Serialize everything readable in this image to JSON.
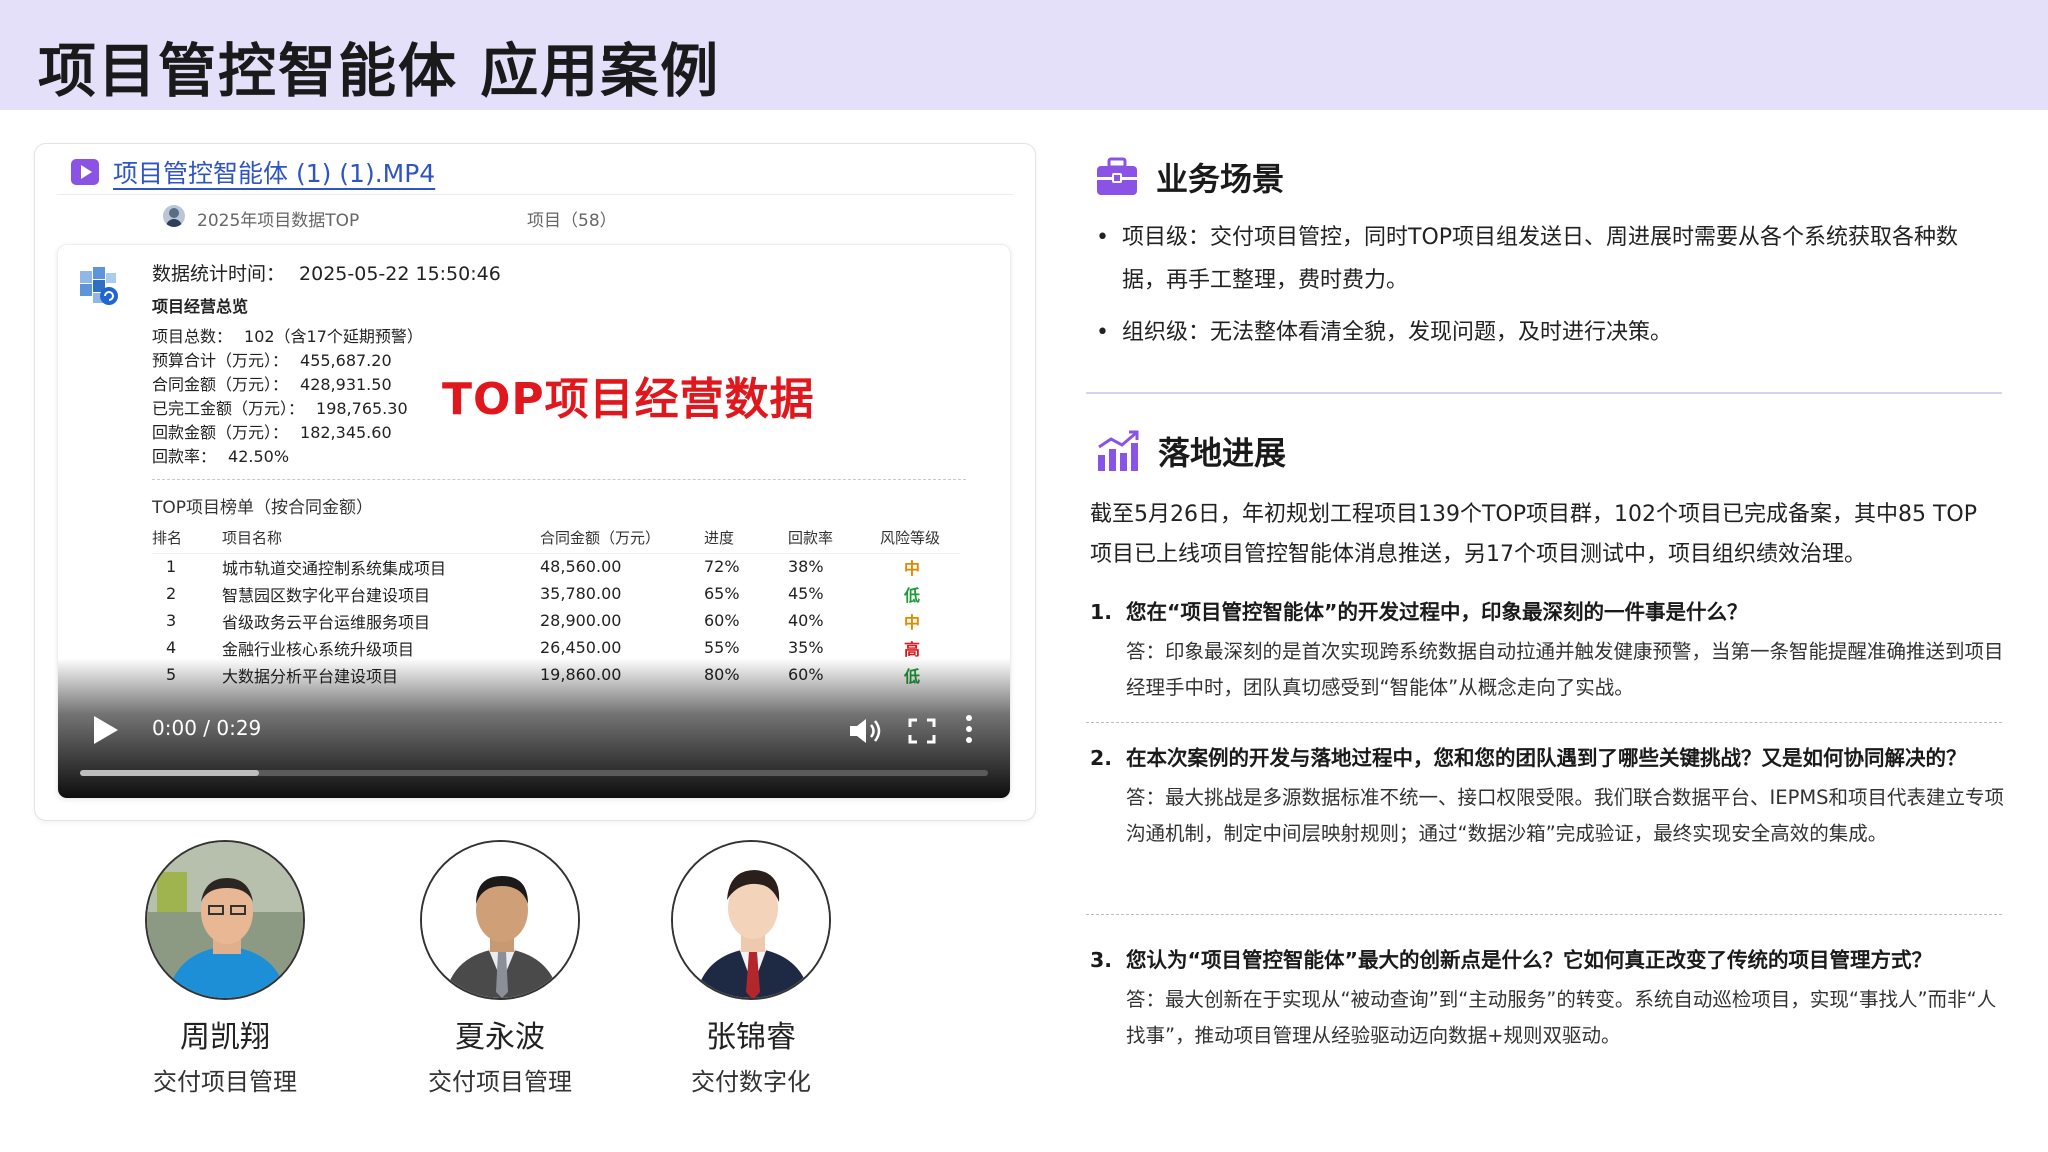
{
  "header": {
    "title": "项目管控智能体 应用案例"
  },
  "video": {
    "file_name": "项目管控智能体 (1) (1).MP4",
    "meta_left": "2025年项目数据TOP",
    "meta_right": "项目（58）",
    "stat_time_label": "数据统计时间：",
    "stat_time_value": "2025-05-22 15:50:46",
    "overview_heading": "项目经营总览",
    "stats": [
      {
        "label": "项目总数：",
        "value": "102（含17个延期预警）"
      },
      {
        "label": "预算合计（万元）：",
        "value": "455,687.20"
      },
      {
        "label": "合同金额（万元）：",
        "value": "428,931.50"
      },
      {
        "label": "已完工金额（万元）：",
        "value": "198,765.30"
      },
      {
        "label": "回款金额（万元）：",
        "value": "182,345.60"
      },
      {
        "label": "回款率：",
        "value": "42.50%"
      }
    ],
    "overlay_label": "TOP项目经营数据",
    "ranking_title": "TOP项目榜单（按合同金额）",
    "ranking_headers": [
      "排名",
      "项目名称",
      "合同金额（万元）",
      "进度",
      "回款率",
      "风险等级"
    ],
    "ranking_rows": [
      {
        "rank": "1",
        "name": "城市轨道交通控制系统集成项目",
        "amount": "48,560.00",
        "progress": "72%",
        "collection": "38%",
        "risk": "中",
        "risk_color": "#e08a00"
      },
      {
        "rank": "2",
        "name": "智慧园区数字化平台建设项目",
        "amount": "35,780.00",
        "progress": "65%",
        "collection": "45%",
        "risk": "低",
        "risk_color": "#1f9a3a"
      },
      {
        "rank": "3",
        "name": "省级政务云平台运维服务项目",
        "amount": "28,900.00",
        "progress": "60%",
        "collection": "40%",
        "risk": "中",
        "risk_color": "#e08a00"
      },
      {
        "rank": "4",
        "name": "金融行业核心系统升级项目",
        "amount": "26,450.00",
        "progress": "55%",
        "collection": "35%",
        "risk": "高",
        "risk_color": "#e0171c"
      },
      {
        "rank": "5",
        "name": "大数据分析平台建设项目",
        "amount": "19,860.00",
        "progress": "80%",
        "collection": "60%",
        "risk": "低",
        "risk_color": "#1f9a3a"
      }
    ],
    "time_display": "0:00 / 0:29",
    "playback_fraction": 0.0
  },
  "people": [
    {
      "name": "周凯翔",
      "role": "交付项目管理"
    },
    {
      "name": "夏永波",
      "role": "交付项目管理"
    },
    {
      "name": "张锦睿",
      "role": "交付数字化"
    }
  ],
  "business": {
    "title": "业务场景",
    "bullets": [
      "项目级：交付项目管控，同时TOP项目组发送日、周进展时需要从各个系统获取各种数据，再手工整理，费时费力。",
      "组织级：无法整体看清全貌，发现问题，及时进行决策。"
    ]
  },
  "progress_section": {
    "title": "落地进展",
    "text": "截至5月26日，年初规划工程项目139个TOP项目群，102个项目已完成备案，其中85 TOP项目已上线项目管控智能体消息推送，另17个项目测试中，项目组织绩效治理。",
    "qa": [
      {
        "num": "1.",
        "q": "您在“项目管控智能体”的开发过程中，印象最深刻的一件事是什么？",
        "a": "答：印象最深刻的是首次实现跨系统数据自动拉通并触发健康预警，当第一条智能提醒准确推送到项目经理手中时，团队真切感受到“智能体”从概念走向了实战。"
      },
      {
        "num": "2.",
        "q": "在本次案例的开发与落地过程中，您和您的团队遇到了哪些关键挑战？又是如何协同解决的？",
        "a": "答：最大挑战是多源数据标准不统一、接口权限受限。我们联合数据平台、IEPMS和项目代表建立专项沟通机制，制定中间层映射规则；通过“数据沙箱”完成验证，最终实现安全高效的集成。"
      },
      {
        "num": "3.",
        "q": "您认为“项目管控智能体”最大的创新点是什么？它如何真正改变了传统的项目管理方式？",
        "a": "答：最大创新在于实现从“被动查询”到“主动服务”的转变。系统自动巡检项目，实现“事找人”而非“人找事”，推动项目管理从经验驱动迈向数据+规则双驱动。"
      }
    ]
  },
  "colors": {
    "header_bg": "#e4e0fa",
    "accent_purple": "#8a53e6",
    "overlay_red": "#e0171c",
    "link_blue": "#2f54c4"
  }
}
